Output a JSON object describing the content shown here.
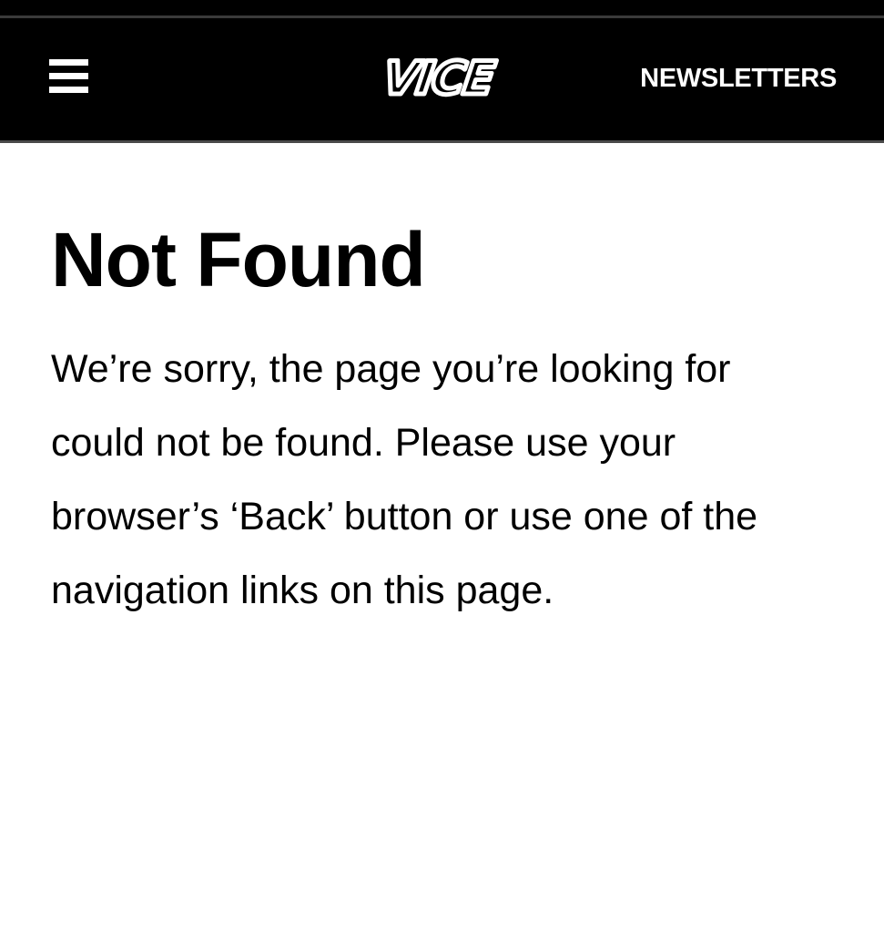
{
  "header": {
    "menu_icon": "hamburger-menu-icon",
    "logo_text": "VICE",
    "newsletters_label": "NEWSLETTERS"
  },
  "main": {
    "title": "Not Found",
    "message": "We’re sorry, the page you’re looking for could not be found. Please use your browser’s ‘Back’ button or use one of the navigation links on this page."
  },
  "colors": {
    "header_background": "#000000",
    "header_text": "#ffffff",
    "page_background": "#ffffff",
    "body_text": "#000000"
  }
}
